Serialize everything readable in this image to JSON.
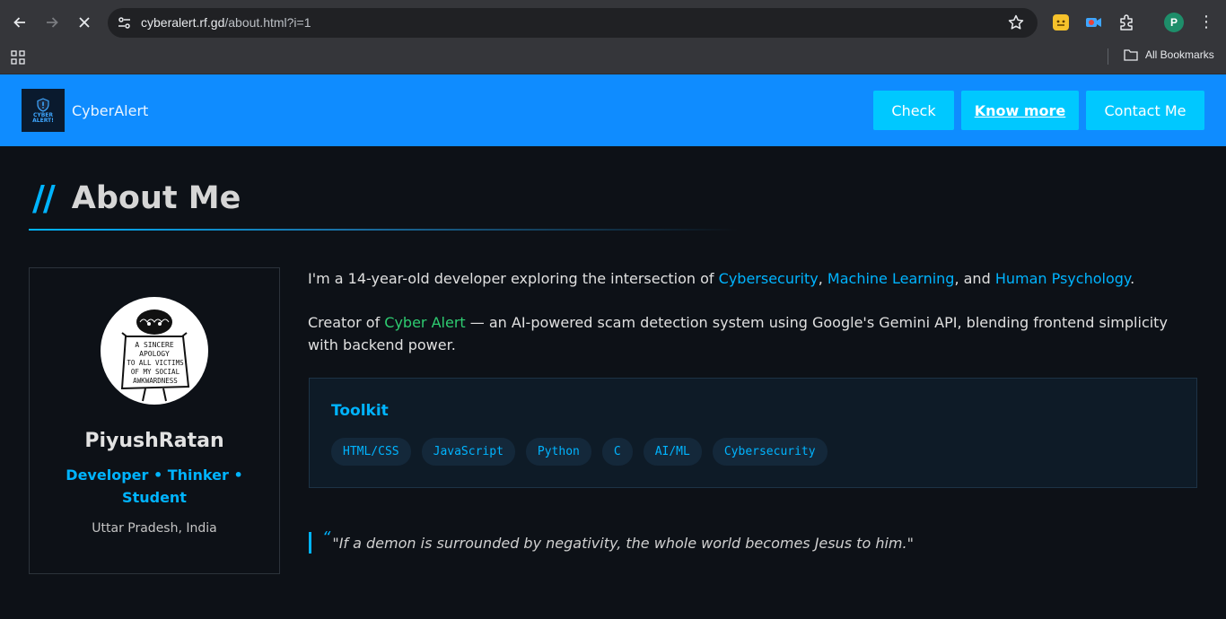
{
  "browser": {
    "url_host": "cyberalert.rf.gd",
    "url_path": "/about.html?i=1",
    "profile_initial": "P",
    "bookmarks_folder": "All Bookmarks"
  },
  "header": {
    "logo_text_line1": "CYBER",
    "logo_text_line2": "ALERT!",
    "brand": "CyberAlert",
    "nav": {
      "check": "Check",
      "know_more": "Know more",
      "contact": "Contact Me"
    }
  },
  "about": {
    "slashes": "//",
    "title": "About Me"
  },
  "profile": {
    "avatar_sign": [
      "A SINCERE",
      "APOLOGY",
      "TO ALL VICTIMS",
      "OF MY SOCIAL",
      "AWKWARDNESS"
    ],
    "name": "PiyushRatan",
    "role": "Developer • Thinker • Student",
    "location": "Uttar Pradesh, India"
  },
  "bio": {
    "p1_a": "I'm a 14-year-old developer exploring the intersection of ",
    "p1_h1": "Cybersecurity",
    "p1_b": ", ",
    "p1_h2": "Machine Learning",
    "p1_c": ", and ",
    "p1_h3": "Human Psychology",
    "p1_d": ".",
    "p2_a": "Creator of ",
    "p2_h1": "Cyber Alert",
    "p2_b": " — an AI-powered scam detection system using Google's Gemini API, blending frontend simplicity with backend power."
  },
  "toolkit": {
    "title": "Toolkit",
    "items": [
      "HTML/CSS",
      "JavaScript",
      "Python",
      "C",
      "AI/ML",
      "Cybersecurity"
    ]
  },
  "quote": {
    "mark": "“",
    "text": "\"If a demon is surrounded by negativity, the whole world becomes Jesus to him.\""
  },
  "colors": {
    "header_bg": "#0f8cff",
    "button_bg": "#00c8ff",
    "accent": "#00b4ff",
    "accent_green": "#2ecc71",
    "page_bg": "#0d1117"
  }
}
